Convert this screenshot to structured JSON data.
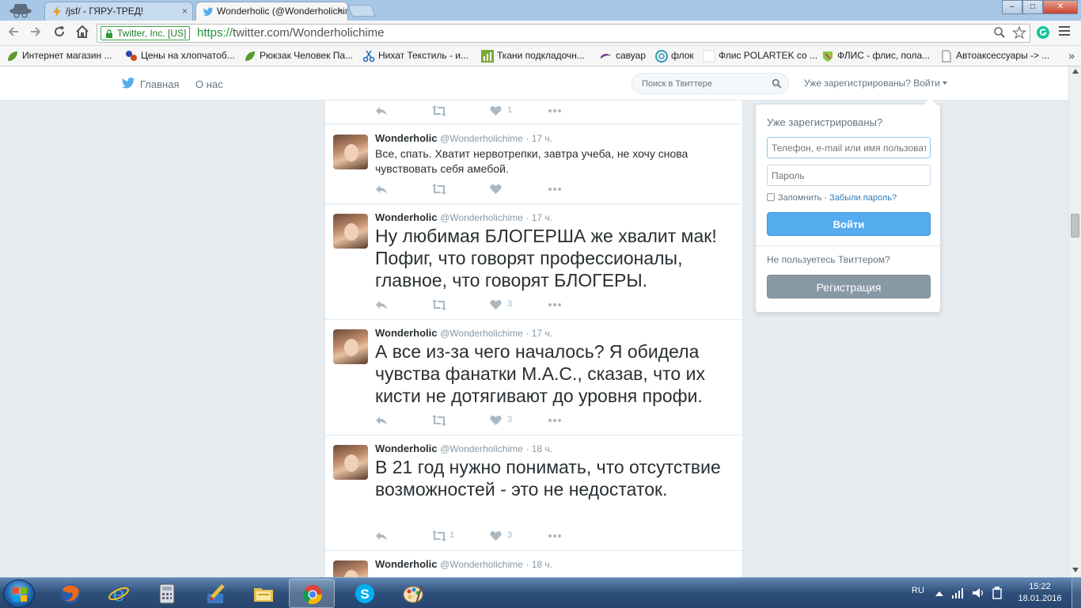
{
  "browser": {
    "tabs": [
      {
        "title": "/jsf/ - ГЯРУ-ТРЕД!",
        "close": "×",
        "icon": "lightning-icon"
      },
      {
        "title": "Wonderholic (@Wonderholichime",
        "close": "×",
        "icon": "twitter-bird-icon"
      }
    ],
    "window_buttons": {
      "minimize": "–",
      "maximize": "□",
      "close": "✕"
    },
    "address": {
      "ev_badge": "Twitter, Inc. [US]",
      "protocol": "https://",
      "url_rest": "twitter.com/Wonderholichime"
    },
    "bookmarks": [
      "Интернет магазин ...",
      "Цены на хлопчатоб...",
      "Рюкзак Человек Па...",
      "Нихат Текстиль - и...",
      "Ткани подкладочн...",
      "савуар",
      "флок",
      "Флис POLARTEK со ...",
      "ФЛИС - флис, пола...",
      "Автоаксессуары -> ..."
    ],
    "bookmarks_more": "»"
  },
  "twitter": {
    "nav": {
      "home": "Главная",
      "about": "О нас"
    },
    "search_placeholder": "Поиск в Твиттере",
    "login_link": "Уже зарегистрированы? Войти",
    "top_actions_like_count": "1",
    "tweets": [
      {
        "name": "Wonderholic",
        "handle": "@Wonderholichime",
        "time": "· 17 ч.",
        "text": "Все, спать. Хватит нервотрепки, завтра учеба, не хочу снова чувствовать себя амебой.",
        "retweets": "",
        "likes": ""
      },
      {
        "name": "Wonderholic",
        "handle": "@Wonderholichime",
        "time": "· 17 ч.",
        "text": "Ну любимая БЛОГЕРША же хвалит мак! Пофиг, что говорят профессионалы, главное, что говорят БЛОГЕРЫ.",
        "retweets": "",
        "likes": "3"
      },
      {
        "name": "Wonderholic",
        "handle": "@Wonderholichime",
        "time": "· 17 ч.",
        "text": "А все из-за чего началось? Я обидела чувства фанатки M.A.C., сказав, что их кисти не дотягивают до уровня профи.",
        "retweets": "",
        "likes": "3"
      },
      {
        "name": "Wonderholic",
        "handle": "@Wonderholichime",
        "time": "· 18 ч.",
        "text": "В 21 год нужно понимать, что отсутствие возможностей - это не недостаток.",
        "retweets": "1",
        "likes": "3"
      },
      {
        "name": "Wonderholic",
        "handle": "@Wonderholichime",
        "time": "· 18 ч.",
        "text": "",
        "retweets": "",
        "likes": ""
      }
    ],
    "login_box": {
      "title": "Уже зарегистрированы?",
      "user_placeholder": "Телефон, e-mail или имя пользоват",
      "password_placeholder": "Пароль",
      "remember": "Запомнить",
      "separator": " · ",
      "forgot": "Забыли пароль?",
      "signin": "Войти",
      "not_user": "Не пользуетесь Твиттером?",
      "signup": "Регистрация"
    }
  },
  "taskbar": {
    "apps": [
      "firefox-icon",
      "ie-icon",
      "calculator-icon",
      "paint-brush-icon",
      "file-explorer-icon",
      "chrome-icon",
      "skype-icon",
      "paint-icon"
    ],
    "active_app": "chrome-icon",
    "language": "RU",
    "time": "15:22",
    "date": "18.01.2016"
  },
  "colors": {
    "twitter_blue": "#55acee",
    "signup_gray": "#8899a6",
    "ev_green": "#1e9638",
    "page_bg": "#e6ecf0"
  }
}
